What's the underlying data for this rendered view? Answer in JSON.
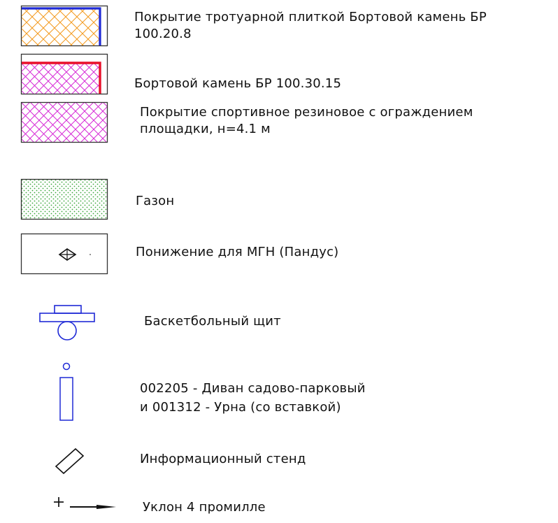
{
  "legend": {
    "items": [
      {
        "id": "paving-tiles",
        "symbol": "orange-hatch-blue-border-icon",
        "lines": [
          "Покрытие тротуарной плиткой Бортовой камень БР",
          "100.20.8"
        ]
      },
      {
        "id": "curb-stone",
        "symbol": "magenta-hatch-red-border-icon",
        "lines": [
          "Бортовой камень БР 100.30.15"
        ]
      },
      {
        "id": "sport-rubber",
        "symbol": "magenta-crosshatch-icon",
        "lines": [
          "Покрытие спортивное резиновое с ограждением",
          "площадки, н=4.1 м"
        ]
      },
      {
        "id": "lawn",
        "symbol": "green-dotted-fill-icon",
        "lines": [
          "Газон"
        ]
      },
      {
        "id": "ramp",
        "symbol": "ramp-icon",
        "lines": [
          "Понижение для МГН (Пандус)"
        ]
      },
      {
        "id": "basketball",
        "symbol": "basketball-backboard-icon",
        "lines": [
          "Баскетбольный щит"
        ]
      },
      {
        "id": "bench-urn",
        "symbol": "bench-urn-icon",
        "lines": [
          "002205 - Диван садово-парковый",
          "и  001312 - Урна (со вставкой)"
        ]
      },
      {
        "id": "info-stand",
        "symbol": "info-stand-icon",
        "lines": [
          "Информационный стенд"
        ]
      },
      {
        "id": "slope",
        "symbol": "slope-arrow-icon",
        "lines": [
          "Уклон 4 промилле"
        ]
      }
    ]
  },
  "colors": {
    "orange": "#f39a1e",
    "blue": "#1f2ad6",
    "red": "#e8102a",
    "magenta": "#d62ad6",
    "green": "#3aa63a",
    "outline": "#333333"
  }
}
